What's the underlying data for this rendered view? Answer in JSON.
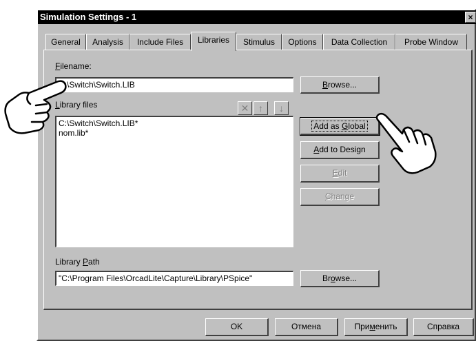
{
  "window": {
    "title": "Simulation Settings - 1",
    "close_glyph": "×"
  },
  "tabs": [
    {
      "label": "General"
    },
    {
      "label": "Analysis"
    },
    {
      "label": "Include Files"
    },
    {
      "label": "Libraries"
    },
    {
      "label": "Stimulus"
    },
    {
      "label": "Options"
    },
    {
      "label": "Data Collection"
    },
    {
      "label": "Probe Window"
    }
  ],
  "active_tab": "Libraries",
  "filename": {
    "label_first": "F",
    "label_rest": "ilename:",
    "value": "C:\\Switch\\Switch.LIB",
    "browse_first": "B",
    "browse_rest": "rowse..."
  },
  "library_files": {
    "label_first": "L",
    "label_rest": "ibrary files",
    "items": [
      "C:\\Switch\\Switch.LIB*",
      "nom.lib*"
    ],
    "delete_icon": "✕",
    "up_icon": "↑",
    "down_icon": "↓"
  },
  "side_buttons": {
    "add_global_pre": "Add as ",
    "add_global_u": "G",
    "add_global_post": "lobal",
    "add_design_u": "A",
    "add_design_post": "dd to Design",
    "edit_u": "E",
    "edit_post": "dit",
    "change_u": "C",
    "change_post": "hange"
  },
  "library_path": {
    "label_pre": "Library ",
    "label_u": "P",
    "label_post": "ath",
    "value": "\"C:\\Program Files\\OrcadLite\\Capture\\Library\\PSpice\"",
    "browse_pre": "Br",
    "browse_u": "o",
    "browse_post": "wse..."
  },
  "bottom_buttons": {
    "ok": "OK",
    "cancel": "Отмена",
    "apply_pre": "При",
    "apply_u": "м",
    "apply_post": "енить",
    "help": "Справка"
  }
}
